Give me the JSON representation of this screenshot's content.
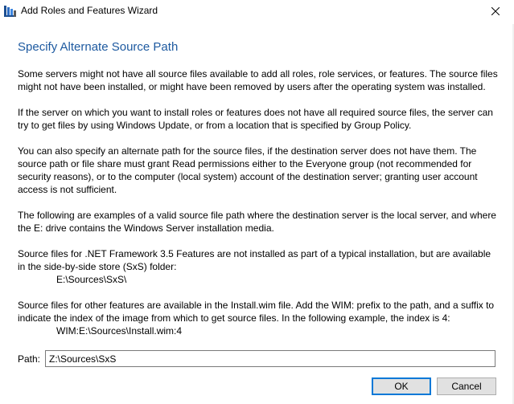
{
  "window": {
    "title": "Add Roles and Features Wizard",
    "icons": {
      "app": "server-manager-icon",
      "close": "close-icon"
    }
  },
  "page": {
    "heading": "Specify Alternate Source Path",
    "paragraphs": [
      "Some servers might not have all source files available to add all roles, role services, or features. The source files might not have been installed, or might have been removed by users after the operating system was installed.",
      "If the server on which you want to install roles or features does not have all required source files, the server can try to get files by using Windows Update, or from a location that is specified by Group Policy.",
      "You can also specify an alternate path for the source files, if the destination server does not have them. The source path or file share must grant Read permissions either to the Everyone group (not recommended for security reasons), or to the computer (local system) account of the destination server; granting user account access is not sufficient.",
      "The following are examples of a valid source file path where the destination server is the local server, and where the E: drive contains the Windows Server installation media.",
      "Source files for .NET Framework 3.5 Features are not installed as part of a typical installation, but are available in the side-by-side store (SxS) folder:",
      "Source files for other features are available in the Install.wim file. Add the WIM: prefix to the path, and a suffix to indicate the index of the image from which to get source files. In the following example, the index is 4:"
    ],
    "examples": {
      "sxs": "E:\\Sources\\SxS\\",
      "wim": "WIM:E:\\Sources\\Install.wim:4"
    }
  },
  "path": {
    "label": "Path:",
    "value": "Z:\\Sources\\SxS"
  },
  "buttons": {
    "ok": "OK",
    "cancel": "Cancel"
  },
  "colors": {
    "heading": "#1e5aa0",
    "accent": "#0078d7"
  }
}
